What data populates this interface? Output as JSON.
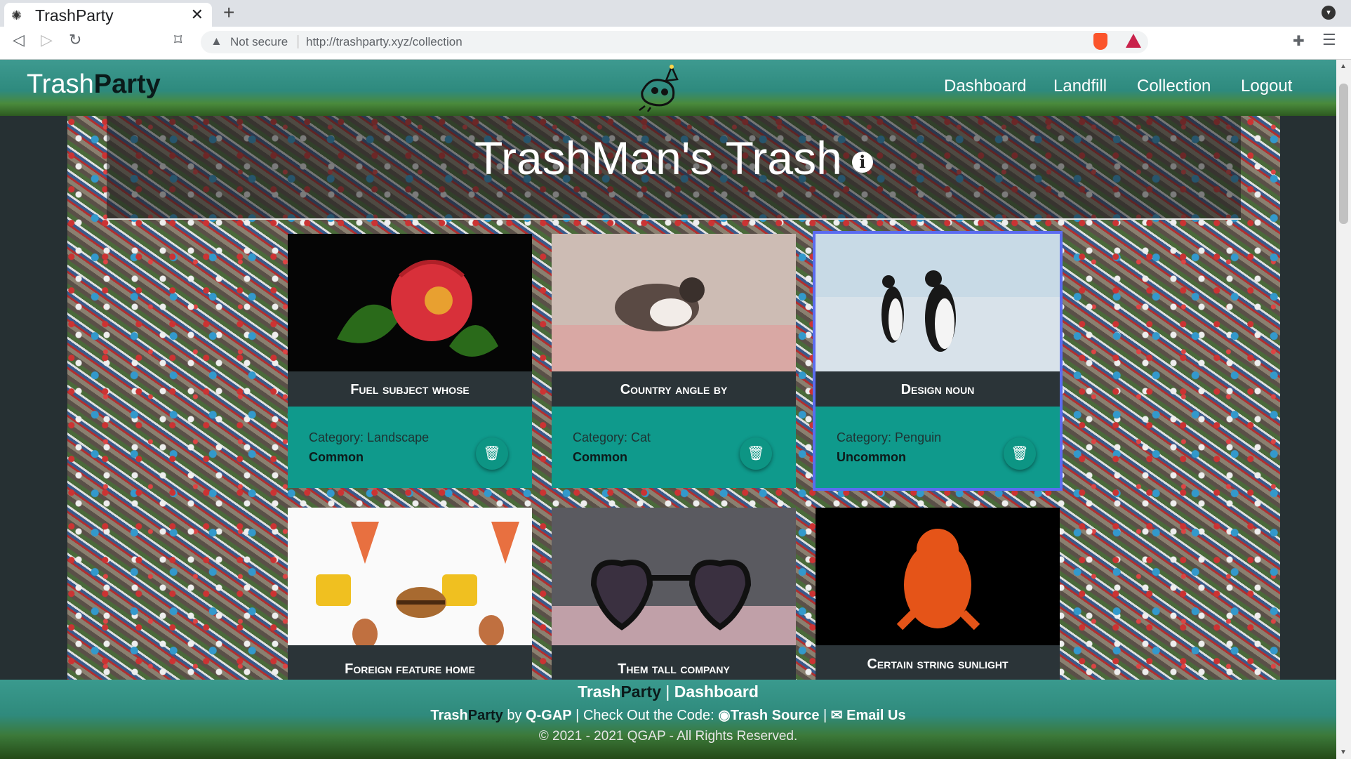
{
  "browser": {
    "tab_title": "TrashParty",
    "security_label": "Not secure",
    "url": "http://trashparty.xyz/collection"
  },
  "navbar": {
    "brand_light": "Trash",
    "brand_bold": "Party",
    "links": [
      "Dashboard",
      "Landfill",
      "Collection",
      "Logout"
    ]
  },
  "hero": {
    "title": "TrashMan's Trash"
  },
  "cards": [
    {
      "title": "Fuel subject whose",
      "category": "Category: Landscape",
      "rarity": "Common",
      "image": "red flower"
    },
    {
      "title": "Country angle by",
      "category": "Category: Cat",
      "rarity": "Common",
      "image": "cat"
    },
    {
      "title": "Design noun",
      "category": "Category: Penguin",
      "rarity": "Uncommon",
      "image": "penguins"
    },
    {
      "title": "Foreign feature home",
      "image": "food emoji"
    },
    {
      "title": "Them tall company",
      "image": "heart sunglasses"
    },
    {
      "title": "Certain string sunlight",
      "image": "orange cartoon"
    }
  ],
  "footer": {
    "line1_brand_light": "Trash",
    "line1_brand_bold": "Party",
    "line1_sep": "|",
    "line1_link": "Dashboard",
    "line2_brand_light": "Trash",
    "line2_brand_bold": "Party",
    "line2_by": "by",
    "line2_author": "Q-GAP",
    "line2_sep1": "|",
    "line2_checkout": "Check Out the Code:",
    "line2_source": "Trash Source",
    "line2_sep2": "|",
    "line2_email": "Email Us",
    "copyright": "© 2021 - 2021 QGAP - All Rights Reserved."
  },
  "colors": {
    "teal": "#0f9a8c",
    "card_dark": "#2b3438",
    "selected_outline": "#5b6cf0"
  }
}
